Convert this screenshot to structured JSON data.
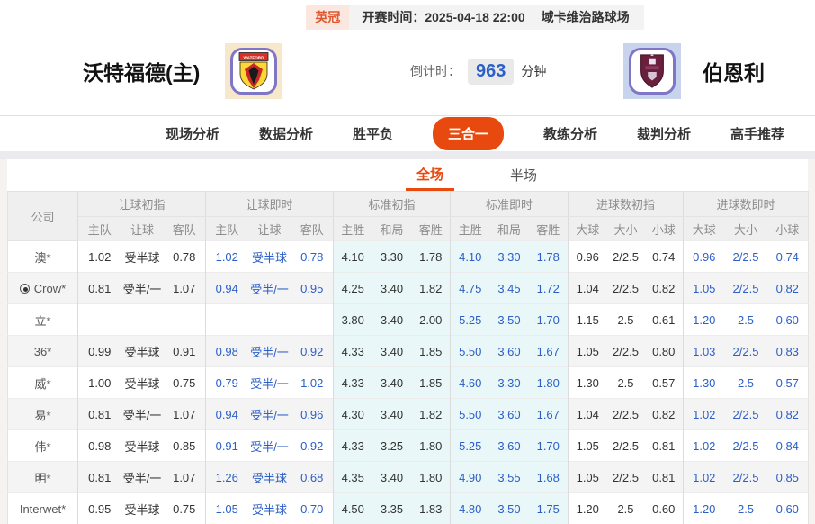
{
  "colors": {
    "accent": "#e8490f",
    "live_blue": "#2b5fc7",
    "std_col_bg": "#e9f7f8",
    "badge_bg": "#fae7df",
    "badge_text": "#e2572f"
  },
  "top_bar": {
    "league": "英冠",
    "kickoff": "开赛时间：2025-04-18 22:00",
    "venue": "域卡维治路球场"
  },
  "header": {
    "home_team": "沃特福德(主)",
    "away_team": "伯恩利",
    "countdown_label": "倒计时：",
    "countdown_value": "963",
    "countdown_unit": "分钟"
  },
  "nav_tabs": [
    {
      "label": "现场分析",
      "active": false
    },
    {
      "label": "数据分析",
      "active": false
    },
    {
      "label": "胜平负",
      "active": false
    },
    {
      "label": "三合一",
      "active": true
    },
    {
      "label": "教练分析",
      "active": false
    },
    {
      "label": "裁判分析",
      "active": false
    },
    {
      "label": "高手推荐",
      "active": false
    }
  ],
  "sub_tabs": [
    {
      "label": "全场",
      "active": true
    },
    {
      "label": "半场",
      "active": false
    }
  ],
  "table": {
    "company_header": "公司",
    "groups": [
      {
        "label": "让球初指",
        "cols": [
          "主队",
          "让球",
          "客队"
        ]
      },
      {
        "label": "让球即时",
        "cols": [
          "主队",
          "让球",
          "客队"
        ]
      },
      {
        "label": "标准初指",
        "cols": [
          "主胜",
          "和局",
          "客胜"
        ]
      },
      {
        "label": "标准即时",
        "cols": [
          "主胜",
          "和局",
          "客胜"
        ]
      },
      {
        "label": "进球数初指",
        "cols": [
          "大球",
          "大小",
          "小球"
        ]
      },
      {
        "label": "进球数即时",
        "cols": [
          "大球",
          "大小",
          "小球"
        ]
      }
    ],
    "rows": [
      {
        "company": "澳*",
        "icon": false,
        "cells": [
          [
            "1.02",
            "受半球",
            "0.78"
          ],
          [
            "1.02",
            "受半球",
            "0.78"
          ],
          [
            "4.10",
            "3.30",
            "1.78"
          ],
          [
            "4.10",
            "3.30",
            "1.78"
          ],
          [
            "0.96",
            "2/2.5",
            "0.74"
          ],
          [
            "0.96",
            "2/2.5",
            "0.74"
          ]
        ]
      },
      {
        "company": "Crow*",
        "icon": true,
        "cells": [
          [
            "0.81",
            "受半/一",
            "1.07"
          ],
          [
            "0.94",
            "受半/一",
            "0.95"
          ],
          [
            "4.25",
            "3.40",
            "1.82"
          ],
          [
            "4.75",
            "3.45",
            "1.72"
          ],
          [
            "1.04",
            "2/2.5",
            "0.82"
          ],
          [
            "1.05",
            "2/2.5",
            "0.82"
          ]
        ]
      },
      {
        "company": "立*",
        "icon": false,
        "cells": [
          [
            "",
            "",
            ""
          ],
          [
            "",
            "",
            ""
          ],
          [
            "3.80",
            "3.40",
            "2.00"
          ],
          [
            "5.25",
            "3.50",
            "1.70"
          ],
          [
            "1.15",
            "2.5",
            "0.61"
          ],
          [
            "1.20",
            "2.5",
            "0.60"
          ]
        ]
      },
      {
        "company": "36*",
        "icon": false,
        "cells": [
          [
            "0.99",
            "受半球",
            "0.91"
          ],
          [
            "0.98",
            "受半/一",
            "0.92"
          ],
          [
            "4.33",
            "3.40",
            "1.85"
          ],
          [
            "5.50",
            "3.60",
            "1.67"
          ],
          [
            "1.05",
            "2/2.5",
            "0.80"
          ],
          [
            "1.03",
            "2/2.5",
            "0.83"
          ]
        ]
      },
      {
        "company": "威*",
        "icon": false,
        "cells": [
          [
            "1.00",
            "受半球",
            "0.75"
          ],
          [
            "0.79",
            "受半/一",
            "1.02"
          ],
          [
            "4.33",
            "3.40",
            "1.85"
          ],
          [
            "4.60",
            "3.30",
            "1.80"
          ],
          [
            "1.30",
            "2.5",
            "0.57"
          ],
          [
            "1.30",
            "2.5",
            "0.57"
          ]
        ]
      },
      {
        "company": "易*",
        "icon": false,
        "cells": [
          [
            "0.81",
            "受半/一",
            "1.07"
          ],
          [
            "0.94",
            "受半/一",
            "0.96"
          ],
          [
            "4.30",
            "3.40",
            "1.82"
          ],
          [
            "5.50",
            "3.60",
            "1.67"
          ],
          [
            "1.04",
            "2/2.5",
            "0.82"
          ],
          [
            "1.02",
            "2/2.5",
            "0.82"
          ]
        ]
      },
      {
        "company": "伟*",
        "icon": false,
        "cells": [
          [
            "0.98",
            "受半球",
            "0.85"
          ],
          [
            "0.91",
            "受半/一",
            "0.92"
          ],
          [
            "4.33",
            "3.25",
            "1.80"
          ],
          [
            "5.25",
            "3.60",
            "1.70"
          ],
          [
            "1.05",
            "2/2.5",
            "0.81"
          ],
          [
            "1.02",
            "2/2.5",
            "0.84"
          ]
        ]
      },
      {
        "company": "明*",
        "icon": false,
        "cells": [
          [
            "0.81",
            "受半/一",
            "1.07"
          ],
          [
            "1.26",
            "受半球",
            "0.68"
          ],
          [
            "4.35",
            "3.40",
            "1.80"
          ],
          [
            "4.90",
            "3.55",
            "1.68"
          ],
          [
            "1.05",
            "2/2.5",
            "0.81"
          ],
          [
            "1.02",
            "2/2.5",
            "0.85"
          ]
        ]
      },
      {
        "company": "Interwet*",
        "icon": false,
        "cells": [
          [
            "0.95",
            "受半球",
            "0.75"
          ],
          [
            "1.05",
            "受半球",
            "0.70"
          ],
          [
            "4.50",
            "3.35",
            "1.83"
          ],
          [
            "4.80",
            "3.50",
            "1.75"
          ],
          [
            "1.20",
            "2.5",
            "0.60"
          ],
          [
            "1.20",
            "2.5",
            "0.60"
          ]
        ]
      }
    ]
  }
}
